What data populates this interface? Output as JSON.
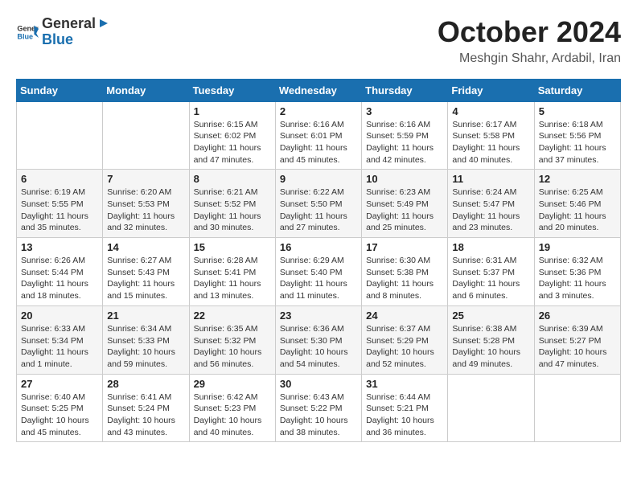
{
  "header": {
    "logo_general": "General",
    "logo_blue": "Blue",
    "month_title": "October 2024",
    "location": "Meshgin Shahr, Ardabil, Iran"
  },
  "days_of_week": [
    "Sunday",
    "Monday",
    "Tuesday",
    "Wednesday",
    "Thursday",
    "Friday",
    "Saturday"
  ],
  "weeks": [
    [
      {
        "day": "",
        "info": ""
      },
      {
        "day": "",
        "info": ""
      },
      {
        "day": "1",
        "info": "Sunrise: 6:15 AM\nSunset: 6:02 PM\nDaylight: 11 hours and 47 minutes."
      },
      {
        "day": "2",
        "info": "Sunrise: 6:16 AM\nSunset: 6:01 PM\nDaylight: 11 hours and 45 minutes."
      },
      {
        "day": "3",
        "info": "Sunrise: 6:16 AM\nSunset: 5:59 PM\nDaylight: 11 hours and 42 minutes."
      },
      {
        "day": "4",
        "info": "Sunrise: 6:17 AM\nSunset: 5:58 PM\nDaylight: 11 hours and 40 minutes."
      },
      {
        "day": "5",
        "info": "Sunrise: 6:18 AM\nSunset: 5:56 PM\nDaylight: 11 hours and 37 minutes."
      }
    ],
    [
      {
        "day": "6",
        "info": "Sunrise: 6:19 AM\nSunset: 5:55 PM\nDaylight: 11 hours and 35 minutes."
      },
      {
        "day": "7",
        "info": "Sunrise: 6:20 AM\nSunset: 5:53 PM\nDaylight: 11 hours and 32 minutes."
      },
      {
        "day": "8",
        "info": "Sunrise: 6:21 AM\nSunset: 5:52 PM\nDaylight: 11 hours and 30 minutes."
      },
      {
        "day": "9",
        "info": "Sunrise: 6:22 AM\nSunset: 5:50 PM\nDaylight: 11 hours and 27 minutes."
      },
      {
        "day": "10",
        "info": "Sunrise: 6:23 AM\nSunset: 5:49 PM\nDaylight: 11 hours and 25 minutes."
      },
      {
        "day": "11",
        "info": "Sunrise: 6:24 AM\nSunset: 5:47 PM\nDaylight: 11 hours and 23 minutes."
      },
      {
        "day": "12",
        "info": "Sunrise: 6:25 AM\nSunset: 5:46 PM\nDaylight: 11 hours and 20 minutes."
      }
    ],
    [
      {
        "day": "13",
        "info": "Sunrise: 6:26 AM\nSunset: 5:44 PM\nDaylight: 11 hours and 18 minutes."
      },
      {
        "day": "14",
        "info": "Sunrise: 6:27 AM\nSunset: 5:43 PM\nDaylight: 11 hours and 15 minutes."
      },
      {
        "day": "15",
        "info": "Sunrise: 6:28 AM\nSunset: 5:41 PM\nDaylight: 11 hours and 13 minutes."
      },
      {
        "day": "16",
        "info": "Sunrise: 6:29 AM\nSunset: 5:40 PM\nDaylight: 11 hours and 11 minutes."
      },
      {
        "day": "17",
        "info": "Sunrise: 6:30 AM\nSunset: 5:38 PM\nDaylight: 11 hours and 8 minutes."
      },
      {
        "day": "18",
        "info": "Sunrise: 6:31 AM\nSunset: 5:37 PM\nDaylight: 11 hours and 6 minutes."
      },
      {
        "day": "19",
        "info": "Sunrise: 6:32 AM\nSunset: 5:36 PM\nDaylight: 11 hours and 3 minutes."
      }
    ],
    [
      {
        "day": "20",
        "info": "Sunrise: 6:33 AM\nSunset: 5:34 PM\nDaylight: 11 hours and 1 minute."
      },
      {
        "day": "21",
        "info": "Sunrise: 6:34 AM\nSunset: 5:33 PM\nDaylight: 10 hours and 59 minutes."
      },
      {
        "day": "22",
        "info": "Sunrise: 6:35 AM\nSunset: 5:32 PM\nDaylight: 10 hours and 56 minutes."
      },
      {
        "day": "23",
        "info": "Sunrise: 6:36 AM\nSunset: 5:30 PM\nDaylight: 10 hours and 54 minutes."
      },
      {
        "day": "24",
        "info": "Sunrise: 6:37 AM\nSunset: 5:29 PM\nDaylight: 10 hours and 52 minutes."
      },
      {
        "day": "25",
        "info": "Sunrise: 6:38 AM\nSunset: 5:28 PM\nDaylight: 10 hours and 49 minutes."
      },
      {
        "day": "26",
        "info": "Sunrise: 6:39 AM\nSunset: 5:27 PM\nDaylight: 10 hours and 47 minutes."
      }
    ],
    [
      {
        "day": "27",
        "info": "Sunrise: 6:40 AM\nSunset: 5:25 PM\nDaylight: 10 hours and 45 minutes."
      },
      {
        "day": "28",
        "info": "Sunrise: 6:41 AM\nSunset: 5:24 PM\nDaylight: 10 hours and 43 minutes."
      },
      {
        "day": "29",
        "info": "Sunrise: 6:42 AM\nSunset: 5:23 PM\nDaylight: 10 hours and 40 minutes."
      },
      {
        "day": "30",
        "info": "Sunrise: 6:43 AM\nSunset: 5:22 PM\nDaylight: 10 hours and 38 minutes."
      },
      {
        "day": "31",
        "info": "Sunrise: 6:44 AM\nSunset: 5:21 PM\nDaylight: 10 hours and 36 minutes."
      },
      {
        "day": "",
        "info": ""
      },
      {
        "day": "",
        "info": ""
      }
    ]
  ]
}
